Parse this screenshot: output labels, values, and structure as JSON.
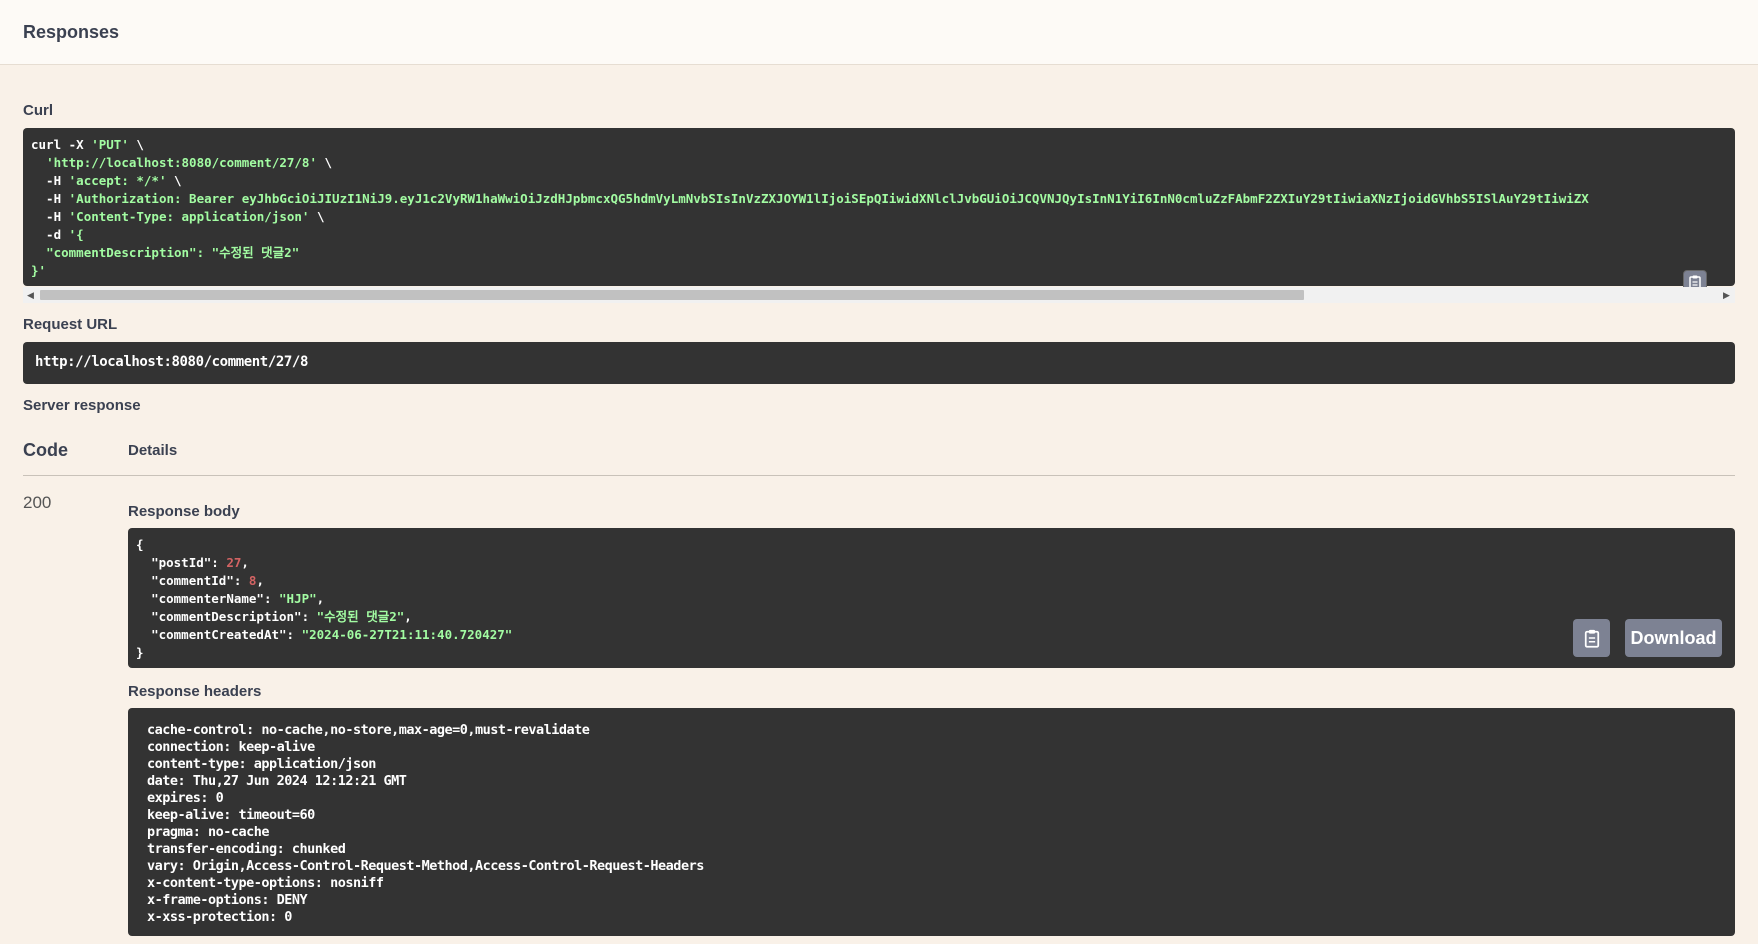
{
  "header": {
    "title": "Responses"
  },
  "curl": {
    "label": "Curl",
    "lines": [
      {
        "plain": "curl -X ",
        "str": "'PUT'",
        "tail": " \\"
      },
      {
        "plain": "  ",
        "str": "'http://localhost:8080/comment/27/8'",
        "tail": " \\"
      },
      {
        "plain": "  -H ",
        "str": "'accept: */*'",
        "tail": " \\"
      },
      {
        "plain": "  -H ",
        "str": "'Authorization: Bearer eyJhbGciOiJIUzI1NiJ9.eyJ1c2VyRW1haWwiOiJzdHJpbmcxQG5hdmVyLmNvbSIsInVzZXJOYW1lIjoiSEpQIiwidXNlclJvbGUiOiJCQVNJQyIsInN1YiI6InN0cmluZzFAbmF2ZXIuY29tIiwiaXNzIjoidGVhbS5ISlAuY29tIiwiZX",
        "tail": ""
      },
      {
        "plain": "  -H ",
        "str": "'Content-Type: application/json'",
        "tail": " \\"
      },
      {
        "plain": "  -d ",
        "str": "'{",
        "tail": ""
      },
      {
        "plain": "  ",
        "str": "\"commentDescription\": \"수정된 댓글2\"",
        "tail": ""
      },
      {
        "plain": "",
        "str": "}'",
        "tail": ""
      }
    ]
  },
  "request_url": {
    "label": "Request URL",
    "value": "http://localhost:8080/comment/27/8"
  },
  "server_response": {
    "label": "Server response",
    "col_code": "Code",
    "col_details": "Details",
    "status_code": "200",
    "body_label": "Response body",
    "download_label": "Download",
    "headers_label": "Response headers",
    "body": {
      "open": "{",
      "close": "}",
      "fields": [
        {
          "key": "\"postId\"",
          "value": "27",
          "kind": "num",
          "comma": ","
        },
        {
          "key": "\"commentId\"",
          "value": "8",
          "kind": "num",
          "comma": ","
        },
        {
          "key": "\"commenterName\"",
          "value": "\"HJP\"",
          "kind": "str",
          "comma": ","
        },
        {
          "key": "\"commentDescription\"",
          "value": "\"수정된 댓글2\"",
          "kind": "str",
          "comma": ","
        },
        {
          "key": "\"commentCreatedAt\"",
          "value": "\"2024-06-27T21:11:40.720427\"",
          "kind": "str",
          "comma": ""
        }
      ]
    },
    "headers": [
      "cache-control: no-cache,no-store,max-age=0,must-revalidate",
      "connection: keep-alive",
      "content-type: application/json",
      "date: Thu,27 Jun 2024 12:12:21 GMT",
      "expires: 0",
      "keep-alive: timeout=60",
      "pragma: no-cache",
      "transfer-encoding: chunked",
      "vary: Origin,Access-Control-Request-Method,Access-Control-Request-Headers",
      "x-content-type-options: nosniff",
      "x-frame-options: DENY",
      "x-xss-protection: 0"
    ]
  },
  "icons": {
    "copy": "clipboard-icon",
    "scroll_left": "scroll-left-arrow-icon",
    "scroll_right": "scroll-right-arrow-icon"
  },
  "colors": {
    "background": "#f9f1e8",
    "code_bg": "#333333",
    "string": "#a2fca2",
    "number": "#d36363",
    "button": "#7d8293"
  }
}
